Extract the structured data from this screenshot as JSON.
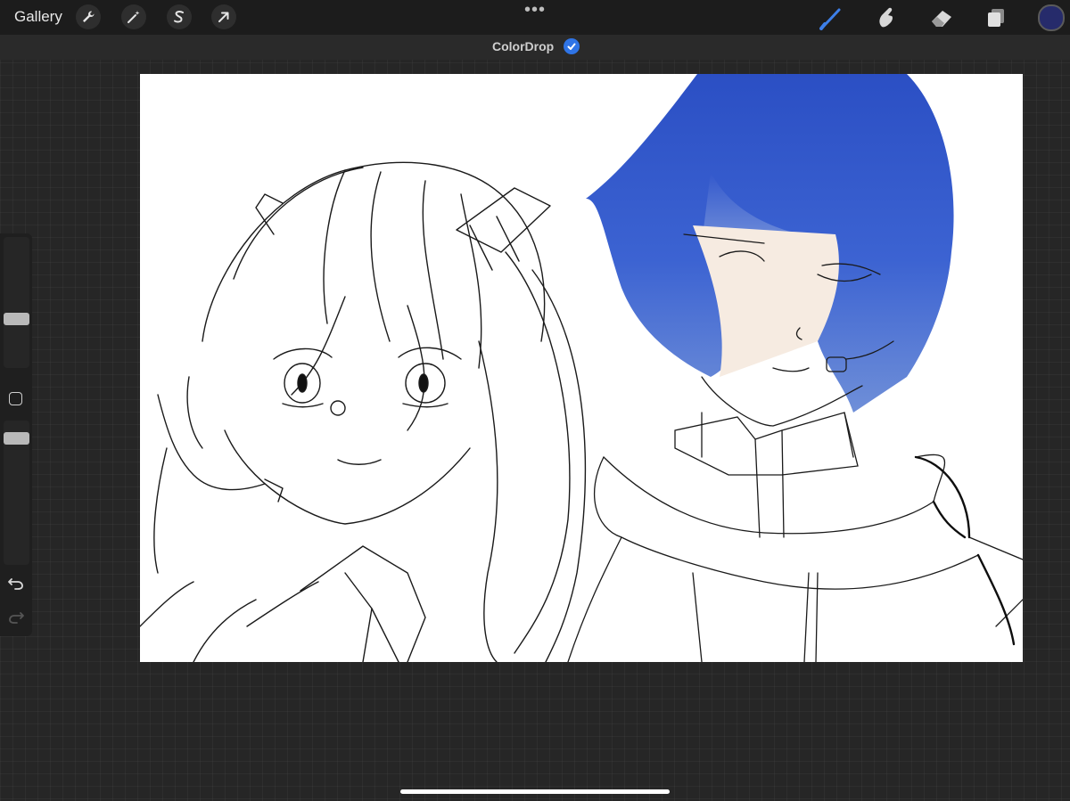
{
  "app": {
    "gallery_label": "Gallery",
    "more_label": "•••"
  },
  "toolbar_left": [
    {
      "name": "actions",
      "icon": "wrench-icon"
    },
    {
      "name": "adjustments",
      "icon": "magic-wand-icon"
    },
    {
      "name": "selection",
      "icon": "selection-s-icon"
    },
    {
      "name": "transform",
      "icon": "arrow-cursor-icon"
    }
  ],
  "toolbar_right": [
    {
      "name": "brush",
      "icon": "brush-icon",
      "active": true
    },
    {
      "name": "smudge",
      "icon": "smudge-finger-icon"
    },
    {
      "name": "eraser",
      "icon": "eraser-icon"
    },
    {
      "name": "layers",
      "icon": "layers-icon"
    }
  ],
  "current_color": "#262b6b",
  "accent_color": "#2f74e6",
  "notification": {
    "label": "ColorDrop",
    "icon": "checkmark-icon"
  },
  "sidebar": {
    "brush_size_level": 0.45,
    "opacity_level": 0.95
  },
  "canvas": {
    "background": "#ffffff",
    "artwork": "line-art"
  }
}
